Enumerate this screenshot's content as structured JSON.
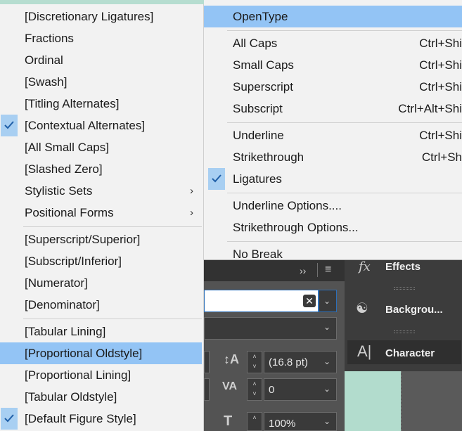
{
  "left_menu": {
    "groups": [
      [
        {
          "label": "[Discretionary Ligatures]",
          "checked": false,
          "submenu": false,
          "highlighted": false
        },
        {
          "label": "Fractions",
          "checked": false,
          "submenu": false,
          "highlighted": false
        },
        {
          "label": "Ordinal",
          "checked": false,
          "submenu": false,
          "highlighted": false
        },
        {
          "label": "[Swash]",
          "checked": false,
          "submenu": false,
          "highlighted": false
        },
        {
          "label": "[Titling Alternates]",
          "checked": false,
          "submenu": false,
          "highlighted": false
        },
        {
          "label": "[Contextual Alternates]",
          "checked": true,
          "submenu": false,
          "highlighted": false
        },
        {
          "label": "[All Small Caps]",
          "checked": false,
          "submenu": false,
          "highlighted": false
        },
        {
          "label": "[Slashed Zero]",
          "checked": false,
          "submenu": false,
          "highlighted": false
        },
        {
          "label": "Stylistic Sets",
          "checked": false,
          "submenu": true,
          "highlighted": false
        },
        {
          "label": "Positional Forms",
          "checked": false,
          "submenu": true,
          "highlighted": false
        }
      ],
      [
        {
          "label": "[Superscript/Superior]",
          "checked": false,
          "submenu": false,
          "highlighted": false
        },
        {
          "label": "[Subscript/Inferior]",
          "checked": false,
          "submenu": false,
          "highlighted": false
        },
        {
          "label": "[Numerator]",
          "checked": false,
          "submenu": false,
          "highlighted": false
        },
        {
          "label": "[Denominator]",
          "checked": false,
          "submenu": false,
          "highlighted": false
        }
      ],
      [
        {
          "label": "[Tabular Lining]",
          "checked": false,
          "submenu": false,
          "highlighted": false
        },
        {
          "label": "[Proportional Oldstyle]",
          "checked": false,
          "submenu": false,
          "highlighted": true
        },
        {
          "label": "[Proportional Lining]",
          "checked": false,
          "submenu": false,
          "highlighted": false
        },
        {
          "label": "[Tabular Oldstyle]",
          "checked": false,
          "submenu": false,
          "highlighted": false
        },
        {
          "label": "[Default Figure Style]",
          "checked": true,
          "submenu": false,
          "highlighted": false
        }
      ]
    ]
  },
  "right_menu": {
    "groups": [
      [
        {
          "label": "OpenType",
          "shortcut": "",
          "checked": false,
          "highlighted": true
        }
      ],
      [
        {
          "label": "All Caps",
          "shortcut": "Ctrl+Shi",
          "checked": false,
          "highlighted": false
        },
        {
          "label": "Small Caps",
          "shortcut": "Ctrl+Shi",
          "checked": false,
          "highlighted": false
        },
        {
          "label": "Superscript",
          "shortcut": "Ctrl+Shi",
          "checked": false,
          "highlighted": false
        },
        {
          "label": "Subscript",
          "shortcut": "Ctrl+Alt+Shi",
          "checked": false,
          "highlighted": false
        }
      ],
      [
        {
          "label": "Underline",
          "shortcut": "Ctrl+Shi",
          "checked": false,
          "highlighted": false
        },
        {
          "label": "Strikethrough",
          "shortcut": "Ctrl+Sh",
          "checked": false,
          "highlighted": false
        },
        {
          "label": "Ligatures",
          "shortcut": "",
          "checked": true,
          "highlighted": false
        }
      ],
      [
        {
          "label": "Underline Options....",
          "shortcut": "",
          "checked": false,
          "highlighted": false
        },
        {
          "label": "Strikethrough Options...",
          "shortcut": "",
          "checked": false,
          "highlighted": false
        }
      ],
      [
        {
          "label": "No Break",
          "shortcut": "",
          "checked": false,
          "highlighted": false
        }
      ]
    ]
  },
  "panel": {
    "leading_value": "(16.8 pt)",
    "tracking_value": "0",
    "vertical_scale_value": "100%",
    "items": {
      "effects": "Effects",
      "background": "Backgrou...",
      "character": "Character"
    },
    "icons": {
      "flyout": "double-chevron-right-icon",
      "menu": "hamburger-icon",
      "clear": "clear-x-icon",
      "effects": "fx-icon",
      "background": "dotted-circle-icon",
      "character": "character-a-icon"
    }
  },
  "colors": {
    "menu_bg": "#f2f2f2",
    "highlight": "#93c4f5",
    "check_bg": "#a8cff2",
    "panel_bg": "#535353",
    "teal_swatch": "#b2dccd"
  }
}
